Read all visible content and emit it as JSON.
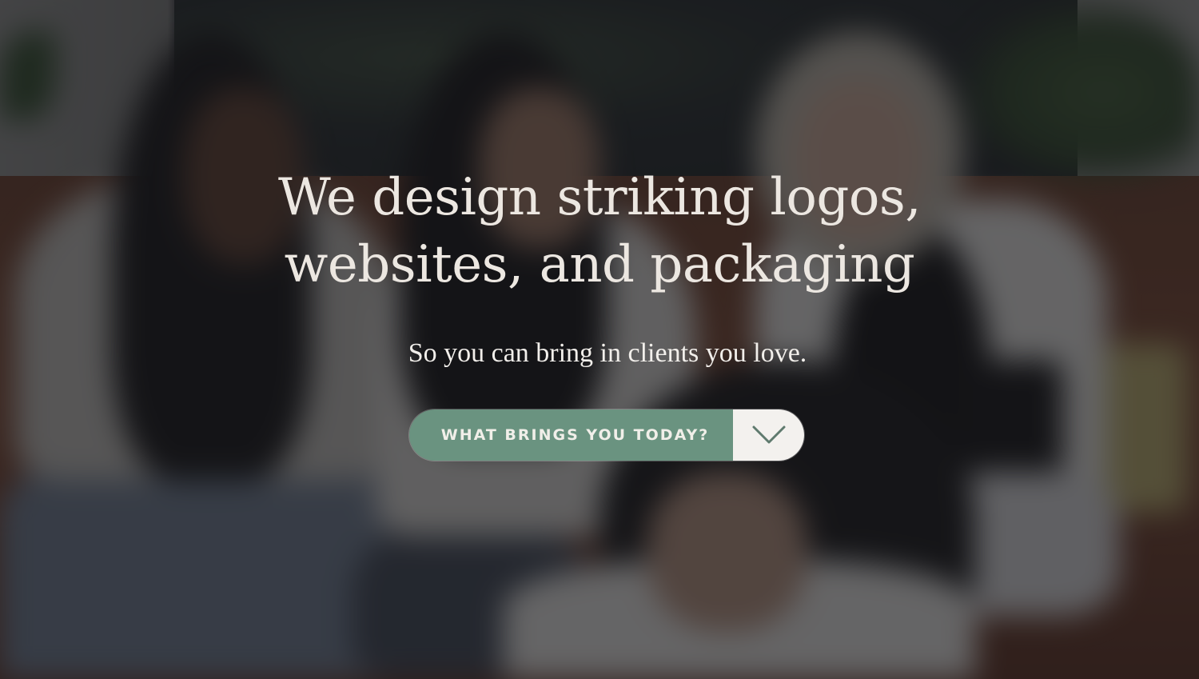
{
  "hero": {
    "headline_line1": "We design striking logos,",
    "headline_line2": "websites, and packaging",
    "subheadline": "So you can bring in clients you love.",
    "cta": {
      "label": "WHAT BRINGS YOU TODAY?",
      "toggle_icon": "chevron-down-icon"
    }
  },
  "colors": {
    "cta_green": "#6a9380",
    "cta_toggle_bg": "#f3f1ee",
    "headline_text": "#ece7e1",
    "overlay": "rgba(22,22,26,0.62)"
  }
}
